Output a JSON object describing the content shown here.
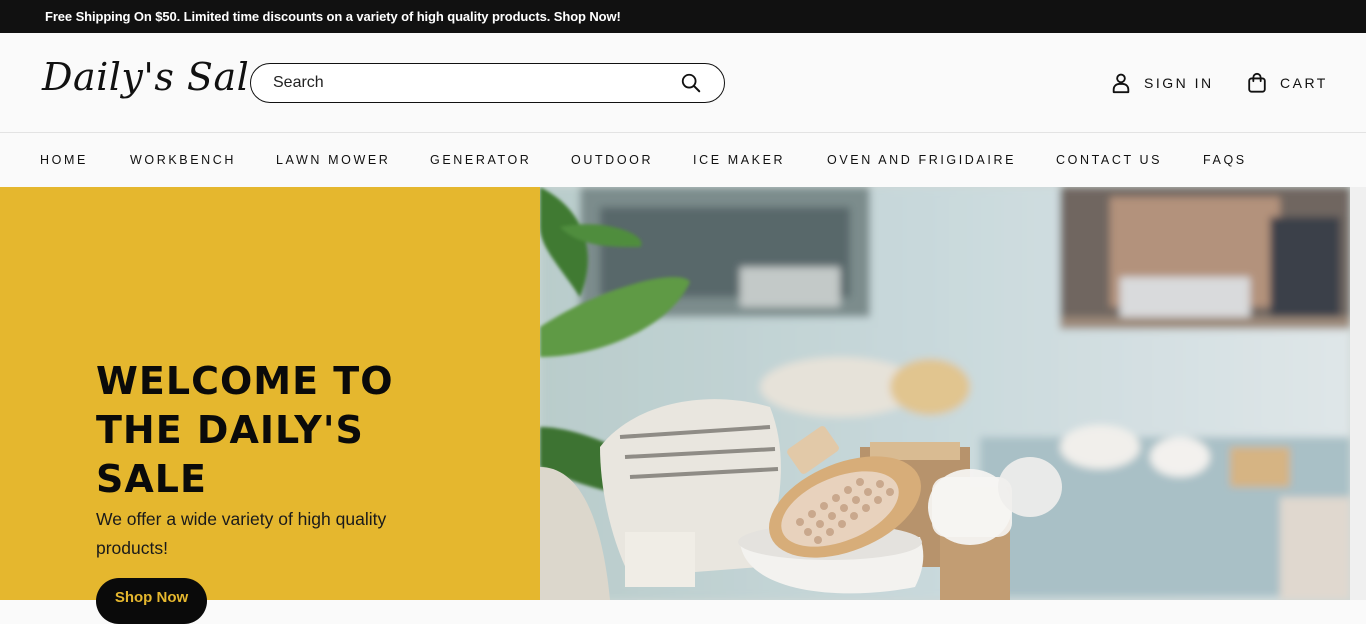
{
  "announcement": "Free Shipping On $50. Limited time discounts on a variety of high quality products. Shop Now!",
  "header": {
    "logo": "Daily's Sale",
    "search_placeholder": "Search",
    "sign_in_label": "SIGN IN",
    "cart_label": "CART"
  },
  "nav": {
    "items": [
      {
        "label": "HOME"
      },
      {
        "label": "WORKBENCH"
      },
      {
        "label": "LAWN MOWER"
      },
      {
        "label": "GENERATOR"
      },
      {
        "label": "OUTDOOR"
      },
      {
        "label": "ICE MAKER"
      },
      {
        "label": "OVEN AND FRIGIDAIRE"
      },
      {
        "label": "CONTACT US"
      },
      {
        "label": "FAQS"
      }
    ]
  },
  "hero": {
    "title": "WELCOME TO THE DAILY'S SALE",
    "subtitle": "We offer a wide variety of high quality products!",
    "button_label": "Shop Now",
    "panel_color": "#E5B72E"
  },
  "icons": {
    "search": "search-icon",
    "user": "user-icon",
    "cart": "shopping-bag-icon"
  }
}
